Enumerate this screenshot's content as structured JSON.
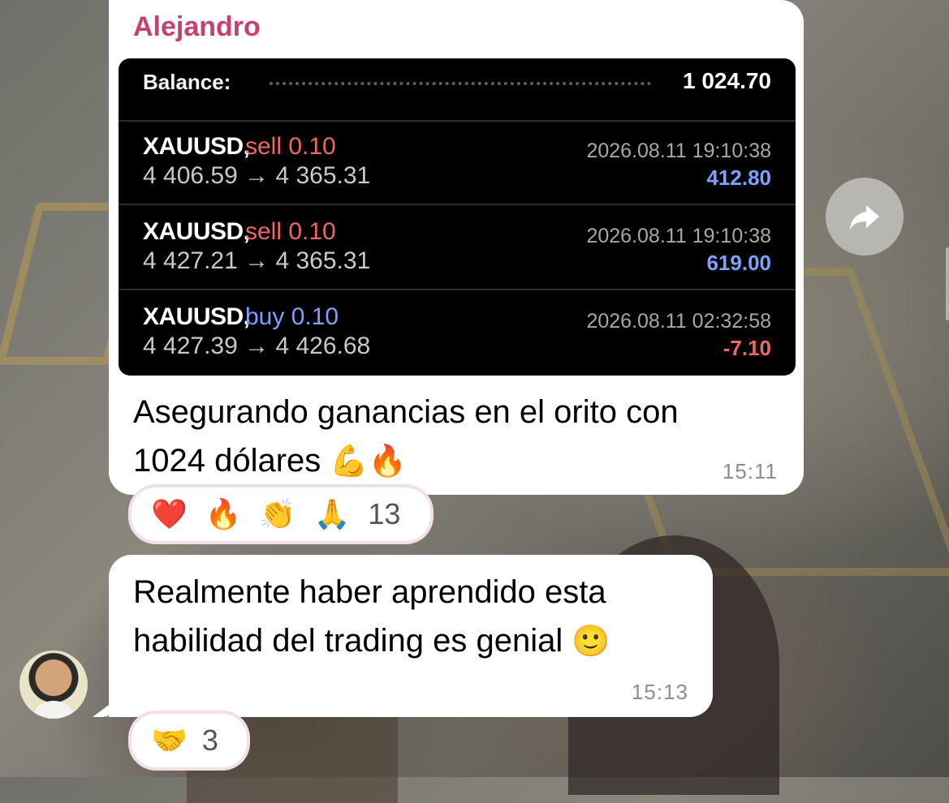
{
  "message1": {
    "sender": "Alejandro",
    "balance_label": "Balance:",
    "balance_value": "1 024.70",
    "trades": [
      {
        "symbol": "XAUUSD,",
        "action": "sell 0.10",
        "prices": "4 406.59 → 4 365.31",
        "time": "2026.08.11 19:10:38",
        "profit": "412.80"
      },
      {
        "symbol": "XAUUSD,",
        "action": "sell 0.10",
        "prices": "4 427.21 → 4 365.31",
        "time": "2026.08.11 19:10:38",
        "profit": "619.00"
      },
      {
        "symbol": "XAUUSD,",
        "action": "buy 0.10",
        "prices": "4 427.39 → 4 426.68",
        "time": "2026.08.11 02:32:58",
        "profit": "-7.10"
      }
    ],
    "text_line1": "Asegurando ganancias en el orito con",
    "text_line2": "1024 dólares",
    "emojis": "💪🔥",
    "time": "15:11",
    "reactions": {
      "items": [
        "❤️",
        "🔥",
        "👏",
        "🙏"
      ],
      "count": "13"
    }
  },
  "message2": {
    "text_line1": "Realmente haber aprendido esta",
    "text_line2": "habilidad del trading es genial",
    "emoji": "🙂",
    "time": "15:13",
    "reactions": {
      "items": [
        "🤝"
      ],
      "count": "3"
    }
  },
  "icons": {
    "share": "share-forward-icon",
    "avatar": "avatar-photo"
  }
}
